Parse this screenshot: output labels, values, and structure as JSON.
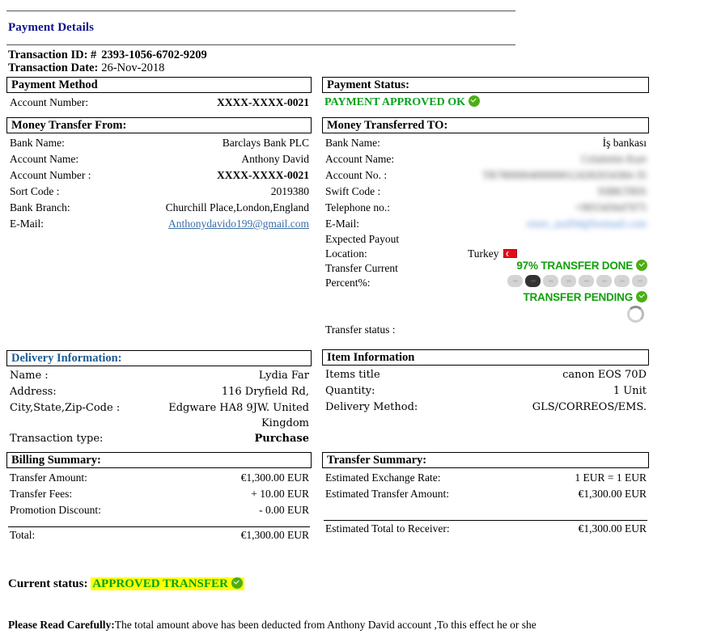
{
  "document": {
    "title": "Payment Details",
    "transaction": {
      "id_label": "Transaction ID: #",
      "id_value": "2393-1056-6702-9209",
      "date_label": "Transaction Date:",
      "date_value": "26-Nov-2018"
    }
  },
  "payment_method": {
    "heading": "Payment Method",
    "rows": [
      {
        "label": "Account Number:",
        "value": "XXXX-XXXX-0021"
      }
    ]
  },
  "payment_status": {
    "heading": "Payment Status:",
    "status_text": "PAYMENT APPROVED OK",
    "status_color": "#00a21c",
    "check_icon": "check-circle-icon"
  },
  "transfer_from": {
    "heading": "Money Transfer From:",
    "rows": [
      {
        "label": "Bank Name:",
        "value": "Barclays Bank PLC"
      },
      {
        "label": "Account Name:",
        "value": "Anthony David"
      },
      {
        "label": "Account Number :",
        "value": "XXXX-XXXX-0021"
      },
      {
        "label": "Sort Code :",
        "value": "2019380"
      },
      {
        "label": "Bank Branch:",
        "value": "Churchill Place,London,England"
      },
      {
        "label": "E-Mail:",
        "value": "Anthonydavido199@gmail.com"
      }
    ]
  },
  "transfer_to": {
    "heading": "Money Transferred TO:",
    "rows": [
      {
        "label": "Bank Name:",
        "value": "İş bankası"
      },
      {
        "label": "Account Name:",
        "value": "Celalettin Kurt"
      },
      {
        "label": "Account No. :",
        "value": "TR7800004000000124282034384 35"
      },
      {
        "label": "Swift Code :",
        "value": "ISBKTRIS"
      },
      {
        "label": "Telephone no.:",
        "value": "+905345647075"
      },
      {
        "label": "E-Mail:",
        "value": "emre_aral94@hotmail.com"
      }
    ],
    "payout_label_line1": "Expected Payout",
    "payout_label_line2": "Location:",
    "payout_value": "Turkey",
    "payout_flag": "turkey-flag-icon",
    "percent_label_line1": "Transfer Current",
    "percent_label_line2": "Percent%:",
    "percent_done_text": "97% TRANSFER DONE",
    "percent_pending_text": "TRANSFER PENDING",
    "progress_segments": 8,
    "progress_active_index": 1,
    "status_label": "Transfer status :",
    "status_value": ""
  },
  "delivery": {
    "heading": "Delivery Information:",
    "rows": [
      {
        "label": "Name :",
        "value": "Lydia Far"
      },
      {
        "label": "Address:",
        "value": "116 Dryfield Rd,"
      },
      {
        "label": "City,State,Zip-Code :",
        "value": "Edgware HA8 9JW. United Kingdom"
      },
      {
        "label": "Transaction type:",
        "value": "Purchase"
      }
    ]
  },
  "item": {
    "heading": "Item Information",
    "rows": [
      {
        "label": "Items title",
        "value": "canon EOS 70D"
      },
      {
        "label": "Quantity:",
        "value": "1 Unit"
      },
      {
        "label": "Delivery Method:",
        "value": "GLS/CORREOS/EMS."
      }
    ]
  },
  "billing": {
    "heading": "Billing Summary:",
    "rows": [
      {
        "label": "Transfer Amount:",
        "value": "€1,300.00 EUR"
      },
      {
        "label": "Transfer Fees:",
        "value": "+ 10.00 EUR"
      },
      {
        "label": "Promotion Discount:",
        "value": "- 0.00 EUR"
      }
    ],
    "total_label": "Total:",
    "total_value": "€1,300.00 EUR"
  },
  "transfer_summary": {
    "heading": "Transfer Summary:",
    "rows": [
      {
        "label": "Estimated  Exchange Rate:",
        "value": "1 EUR = 1  EUR"
      },
      {
        "label": "Estimated  Transfer Amount:",
        "value": "€1,300.00 EUR"
      }
    ],
    "total_label": "Estimated  Total to Receiver:",
    "total_value": "€1,300.00 EUR"
  },
  "footer": {
    "current_status_label": "Current status:",
    "current_status_value": "APPROVED TRANSFER",
    "highlight_color": "#ffff00",
    "note_label": "Please Read Carefully:",
    "note_text": "The total amount above has been deducted from Anthony David account ,To this effect he or she"
  }
}
